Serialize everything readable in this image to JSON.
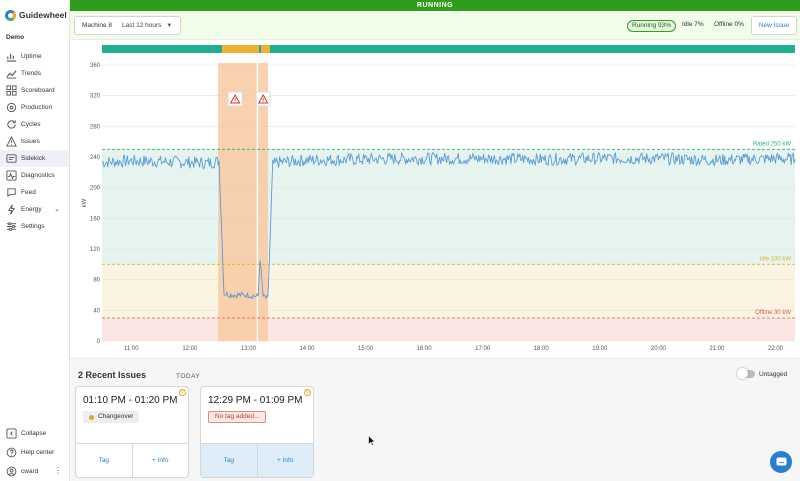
{
  "app": {
    "brand": "Guidewheel",
    "org": "Demo"
  },
  "sidebar": {
    "items": [
      {
        "label": "Uptime",
        "icon": "uptime-icon"
      },
      {
        "label": "Trends",
        "icon": "trends-icon"
      },
      {
        "label": "Scoreboard",
        "icon": "scoreboard-icon"
      },
      {
        "label": "Production",
        "icon": "production-icon"
      },
      {
        "label": "Cycles",
        "icon": "cycles-icon"
      },
      {
        "label": "Issues",
        "icon": "warning-icon"
      },
      {
        "label": "Sidekick",
        "icon": "sidekick-icon",
        "active": true
      },
      {
        "label": "Diagnostics",
        "icon": "diagnostics-icon"
      },
      {
        "label": "Feed",
        "icon": "feed-icon"
      },
      {
        "label": "Energy",
        "icon": "energy-icon"
      },
      {
        "label": "Settings",
        "icon": "settings-icon"
      }
    ],
    "bottom": {
      "collapse": "Collapse",
      "help": "Help center",
      "user": "cward"
    }
  },
  "banner": {
    "status": "RUNNING",
    "color": "#2e9e1a"
  },
  "toolbar": {
    "machine": "Machine 8",
    "range": "Last 12 hours",
    "running": "Running 93%",
    "idle": "Idle 7%",
    "offline": "Offline 0%",
    "new_issue": "New Issue"
  },
  "chart_data": {
    "type": "line",
    "ylabel": "kW",
    "ylim": [
      0,
      360
    ],
    "yticks": [
      "0",
      "40",
      "80",
      "120",
      "160",
      "200",
      "240",
      "280",
      "320",
      "360"
    ],
    "xticks": [
      "11:00",
      "12:00",
      "13:00",
      "14:00",
      "15:00",
      "16:00",
      "17:00",
      "18:00",
      "19:00",
      "20:00",
      "21:00",
      "22:00"
    ],
    "thresholds": [
      {
        "label": "Rated 250 kW",
        "value": 250,
        "color": "#2fb06a"
      },
      {
        "label": "Idle 100 kW",
        "value": 100,
        "color": "#e0b32a"
      },
      {
        "label": "Offline 30 kW",
        "value": 30,
        "color": "#e05a4a"
      }
    ],
    "series": [
      {
        "color": "#5b9bd5",
        "x": [
          "10:30",
          "11:00",
          "11:30",
          "12:00",
          "12:20",
          "12:30",
          "12:35",
          "12:45",
          "13:00",
          "13:10",
          "13:12",
          "13:15",
          "13:20",
          "13:25",
          "13:30",
          "14:00",
          "15:00",
          "16:00",
          "17:00",
          "18:00",
          "19:00",
          "20:00",
          "21:00",
          "22:00",
          "22:20"
        ],
        "y": [
          233,
          235,
          234,
          233,
          232,
          235,
          62,
          60,
          60,
          58,
          108,
          58,
          55,
          230,
          233,
          236,
          237,
          238,
          238,
          237,
          238,
          238,
          236,
          238,
          237
        ]
      }
    ],
    "issues": [
      {
        "start": "12:29",
        "end": "13:09"
      },
      {
        "start": "13:10",
        "end": "13:20"
      }
    ]
  },
  "issues_panel": {
    "title": "2 Recent Issues",
    "today": "TODAY",
    "untagged": "Untagged",
    "cards": [
      {
        "time": "01:10 PM - 01:20 PM",
        "tag": "Changeover",
        "tag_button": "Tag",
        "info_button": "+ Info"
      },
      {
        "time": "12:29 PM - 01:09 PM",
        "tag": "No tag added...",
        "tag_button": "Tag",
        "info_button": "+ Info"
      }
    ]
  }
}
